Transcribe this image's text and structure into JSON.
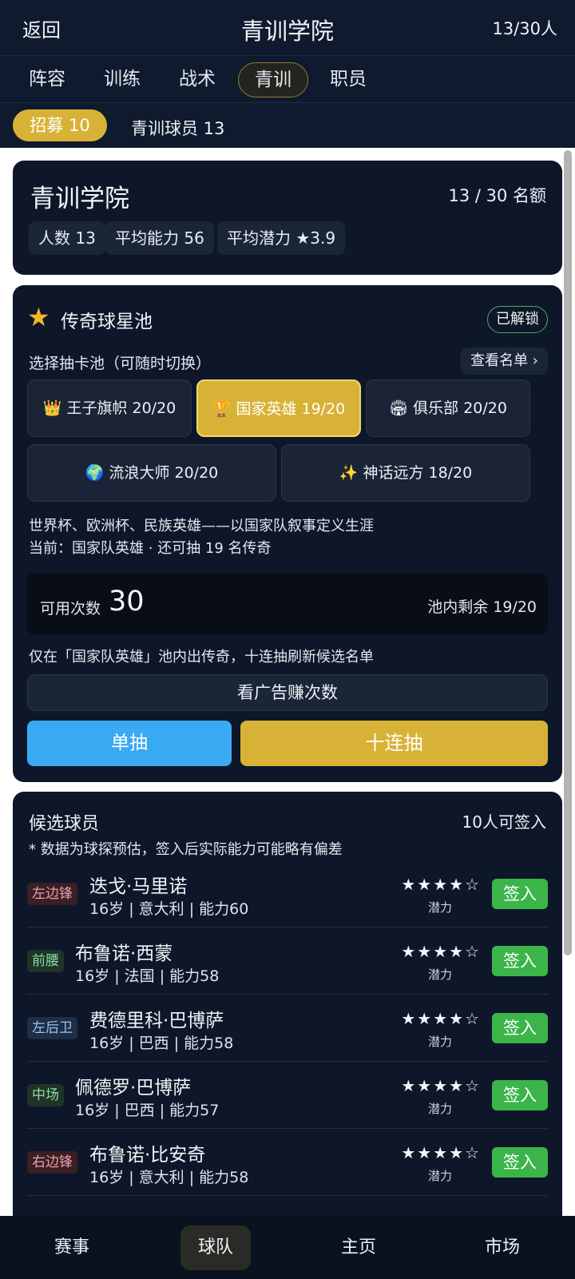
{
  "header": {
    "back": "返回",
    "title": "青训学院",
    "count": "13/30人"
  },
  "tabs": [
    {
      "label": "阵容"
    },
    {
      "label": "训练"
    },
    {
      "label": "战术"
    },
    {
      "label": "青训",
      "active": true
    },
    {
      "label": "职员"
    }
  ],
  "subbar": {
    "recruit": "招募 10",
    "players": "青训球员 13"
  },
  "academy": {
    "title": "青训学院",
    "quota": "13 / 30 名额",
    "stats": [
      "人数 13",
      "平均能力 56",
      "平均潜力 ★3.9"
    ]
  },
  "legend_pool": {
    "title": "传奇球星池",
    "status": "已解锁",
    "select_label": "选择抽卡池（可随时切换）",
    "view_list": "查看名单 ›",
    "pools": [
      {
        "label": "👑 王子旗帜 20/20"
      },
      {
        "label": "🏆 国家英雄 19/20",
        "selected": true
      },
      {
        "label": "🏟 俱乐部 20/20"
      },
      {
        "label": "🌍 流浪大师 20/20"
      },
      {
        "label": "✨ 神话远方 18/20"
      }
    ],
    "desc1": "世界杯、欧洲杯、民族英雄——以国家队叙事定义生涯",
    "desc2": "当前：国家队英雄 · 还可抽 19 名传奇",
    "available_label": "可用次数",
    "available_count": "30",
    "remain": "池内剩余 19/20",
    "note": "仅在「国家队英雄」池内出传奇，十连抽刷新候选名单",
    "ad_button": "看广告赚次数",
    "single_draw": "单抽",
    "ten_draw": "十连抽"
  },
  "candidates": {
    "title": "候选球员",
    "count": "10人可签入",
    "note": "* 数据为球探预估，签入后实际能力可能略有偏差",
    "potential_label": "潜力",
    "sign_label": "签入",
    "players": [
      {
        "position": "左边锋",
        "name": "迭戈·马里诺",
        "meta": "16岁 | 意大利 | 能力60",
        "stars": "★★★★☆",
        "pos_color": "#3a1f24",
        "pos_text": "#e9a1a8"
      },
      {
        "position": "前腰",
        "name": "布鲁诺·西蒙",
        "meta": "16岁 | 法国 | 能力58",
        "stars": "★★★★☆",
        "pos_color": "#1f3328",
        "pos_text": "#8ed9a3"
      },
      {
        "position": "左后卫",
        "name": "费德里科·巴博萨",
        "meta": "16岁 | 巴西 | 能力58",
        "stars": "★★★★☆",
        "pos_color": "#1d2e45",
        "pos_text": "#9cc4f0"
      },
      {
        "position": "中场",
        "name": "佩德罗·巴博萨",
        "meta": "16岁 | 巴西 | 能力57",
        "stars": "★★★★☆",
        "pos_color": "#1f3328",
        "pos_text": "#8ed9a3"
      },
      {
        "position": "右边锋",
        "name": "布鲁诺·比安奇",
        "meta": "16岁 | 意大利 | 能力58",
        "stars": "★★★★☆",
        "pos_color": "#3a1f24",
        "pos_text": "#e9a1a8"
      }
    ]
  },
  "bottom_nav": [
    {
      "label": "赛事"
    },
    {
      "label": "球队",
      "active": true
    },
    {
      "label": "主页"
    },
    {
      "label": "市场"
    }
  ]
}
